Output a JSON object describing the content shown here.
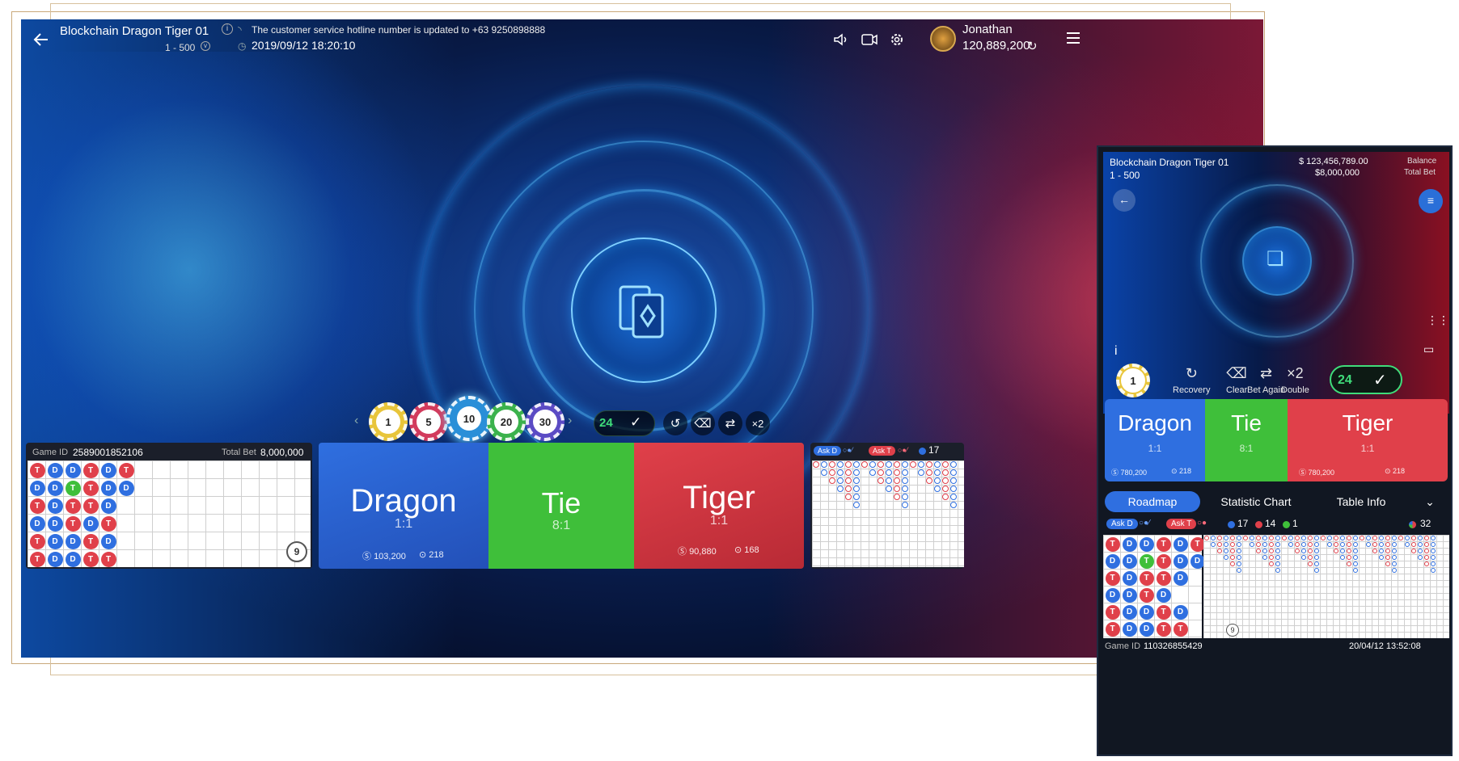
{
  "desktop": {
    "game_title": "Blockchain Dragon Tiger 01",
    "bet_limit": "1 - 500",
    "announcement": "The customer service hotline number is updated to +63 9250898888",
    "datetime": "2019/09/12 18:20:10",
    "user_name": "Jonathan",
    "balance": "120,889,200",
    "chips": [
      "1",
      "5",
      "10",
      "20",
      "30"
    ],
    "countdown": "24",
    "double_label": "×2",
    "roadmap": {
      "game_id_label": "Game ID",
      "game_id": "2589001852106",
      "total_bet_label": "Total Bet",
      "total_bet": "8,000,000",
      "shoe_count": "9",
      "beads": [
        [
          "T",
          "D",
          "D",
          "T",
          "D",
          "T"
        ],
        [
          "D",
          "D",
          "T",
          "T",
          "D",
          "D"
        ],
        [
          "T",
          "D",
          "T",
          "T",
          "D"
        ],
        [
          "D",
          "D",
          "T",
          "D",
          "T"
        ],
        [
          "T",
          "D",
          "D",
          "T",
          "D"
        ],
        [
          "T",
          "D",
          "D",
          "T",
          "T"
        ]
      ]
    },
    "bets": {
      "dragon": {
        "name": "Dragon",
        "odds": "1:1",
        "amount": "103,200",
        "players": "218"
      },
      "tie": {
        "name": "Tie",
        "odds": "8:1"
      },
      "tiger": {
        "name": "Tiger",
        "odds": "1:1",
        "amount": "90,880",
        "players": "168"
      }
    },
    "ask_dragon": "Ask D",
    "ask_tiger": "Ask T",
    "blue_count": "17"
  },
  "mobile": {
    "game_title": "Blockchain Dragon Tiger 01",
    "bet_limit": "1 - 500",
    "balance": "$ 123,456,789.00",
    "balance_label": "Balance",
    "total_bet": "$8,000,000",
    "total_bet_label": "Total Bet",
    "chip": "1",
    "controls": {
      "recovery": "Recovery",
      "clear": "Clear",
      "bet_again": "Bet Again",
      "double": "Double",
      "double_glyph": "×2"
    },
    "countdown": "24",
    "bets": {
      "dragon": {
        "name": "Dragon",
        "odds": "1:1",
        "amount": "780,200",
        "players": "218"
      },
      "tie": {
        "name": "Tie",
        "odds": "8:1"
      },
      "tiger": {
        "name": "Tiger",
        "odds": "1:1",
        "amount": "780,200",
        "players": "218"
      }
    },
    "tabs": [
      "Roadmap",
      "Statistic Chart",
      "Table Info"
    ],
    "ask_dragon": "Ask D",
    "ask_tiger": "Ask T",
    "counts": {
      "blue": "17",
      "red": "14",
      "green": "1",
      "total": "32"
    },
    "shoe_count": "9",
    "beads": [
      [
        "T",
        "D",
        "D",
        "T",
        "D",
        "T"
      ],
      [
        "D",
        "D",
        "T",
        "T",
        "D",
        "D"
      ],
      [
        "T",
        "D",
        "T",
        "T",
        "D"
      ],
      [
        "D",
        "D",
        "T",
        "D"
      ],
      [
        "T",
        "D",
        "D",
        "T",
        "D"
      ],
      [
        "T",
        "D",
        "D",
        "T",
        "T"
      ]
    ],
    "game_id_label": "Game ID",
    "game_id": "110326855429",
    "datetime": "20/04/12 13:52:08"
  },
  "colors": {
    "dragon": "#2f6fe0",
    "tie": "#3fbf3a",
    "tiger": "#e0404a",
    "gold": "#c9a87a"
  }
}
